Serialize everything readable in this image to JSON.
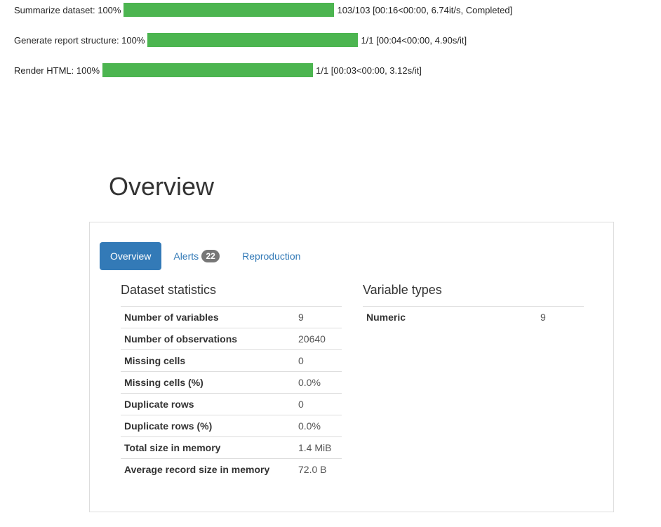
{
  "progress": [
    {
      "label": "Summarize dataset: 100%",
      "fraction": 1.0,
      "status": "103/103 [00:16<00:00, 6.74it/s, Completed]"
    },
    {
      "label": "Generate report structure: 100%",
      "fraction": 1.0,
      "status": "1/1 [00:04<00:00, 4.90s/it]"
    },
    {
      "label": "Render HTML: 100%",
      "fraction": 1.0,
      "status": "1/1 [00:03<00:00, 3.12s/it]"
    }
  ],
  "overview": {
    "title": "Overview",
    "tabs": [
      {
        "label": "Overview",
        "active": true
      },
      {
        "label": "Alerts",
        "badge": "22",
        "active": false
      },
      {
        "label": "Reproduction",
        "active": false
      }
    ],
    "dataset_statistics": {
      "heading": "Dataset statistics",
      "rows": [
        {
          "key": "Number of variables",
          "value": "9"
        },
        {
          "key": "Number of observations",
          "value": "20640"
        },
        {
          "key": "Missing cells",
          "value": "0"
        },
        {
          "key": "Missing cells (%)",
          "value": "0.0%"
        },
        {
          "key": "Duplicate rows",
          "value": "0"
        },
        {
          "key": "Duplicate rows (%)",
          "value": "0.0%"
        },
        {
          "key": "Total size in memory",
          "value": "1.4 MiB"
        },
        {
          "key": "Average record size in memory",
          "value": "72.0 B"
        }
      ]
    },
    "variable_types": {
      "heading": "Variable types",
      "rows": [
        {
          "key": "Numeric",
          "value": "9"
        }
      ]
    }
  },
  "colors": {
    "progress_fill": "#4cb550",
    "accent": "#337ab7",
    "badge": "#777777"
  }
}
